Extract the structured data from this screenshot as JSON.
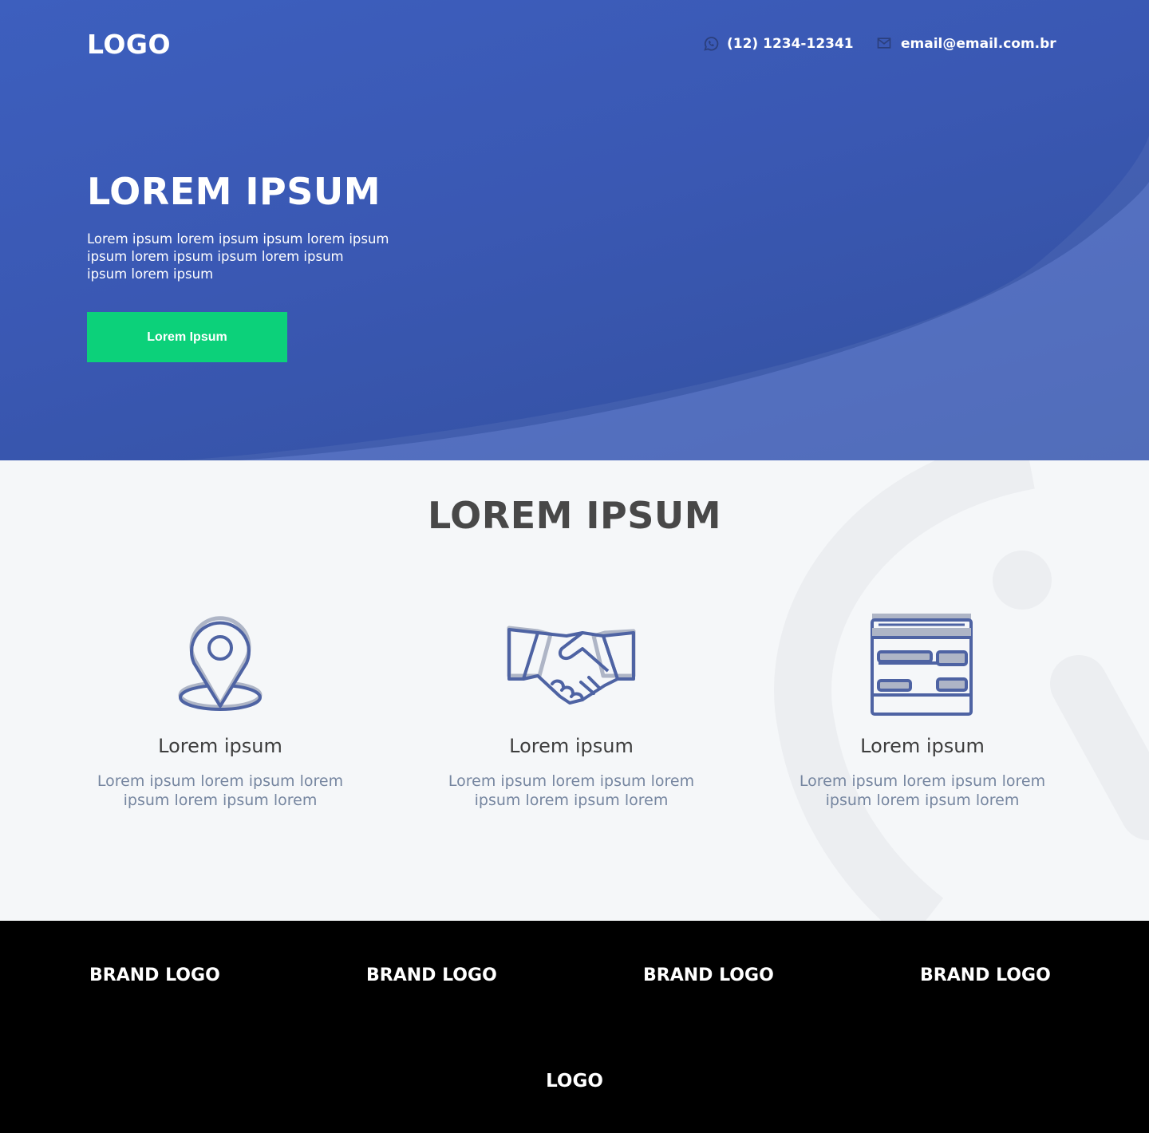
{
  "header": {
    "logo": "LOGO",
    "phone": "(12) 1234-12341",
    "phone_icon": "whatsapp-icon",
    "email": "email@email.com.br",
    "email_icon": "mail-icon"
  },
  "hero": {
    "title": "LOREM IPSUM",
    "text_lines": [
      "Lorem ipsum lorem ipsum ipsum lorem ipsum",
      "ipsum lorem ipsum ipsum lorem ipsum",
      "ipsum lorem ipsum"
    ],
    "cta_label": "Lorem Ipsum"
  },
  "features": {
    "title": "LOREM IPSUM",
    "items": [
      {
        "icon": "location-pin-icon",
        "title": "Lorem ipsum",
        "text": "Lorem ipsum lorem ipsum lorem ipsum lorem ipsum lorem"
      },
      {
        "icon": "handshake-icon",
        "title": "Lorem ipsum",
        "text": "Lorem ipsum lorem ipsum lorem ipsum lorem ipsum lorem"
      },
      {
        "icon": "website-layout-icon",
        "title": "Lorem ipsum",
        "text": "Lorem ipsum lorem ipsum lorem ipsum lorem ipsum lorem"
      }
    ]
  },
  "footer": {
    "brands": [
      "BRAND LOGO",
      "BRAND LOGO",
      "BRAND LOGO",
      "BRAND LOGO"
    ],
    "logo": "LOGO"
  },
  "colors": {
    "hero_blue": "#3a58b3",
    "cta_green": "#0cd17a",
    "icon_blue": "#4e63a3",
    "footer_bg": "#000000"
  }
}
